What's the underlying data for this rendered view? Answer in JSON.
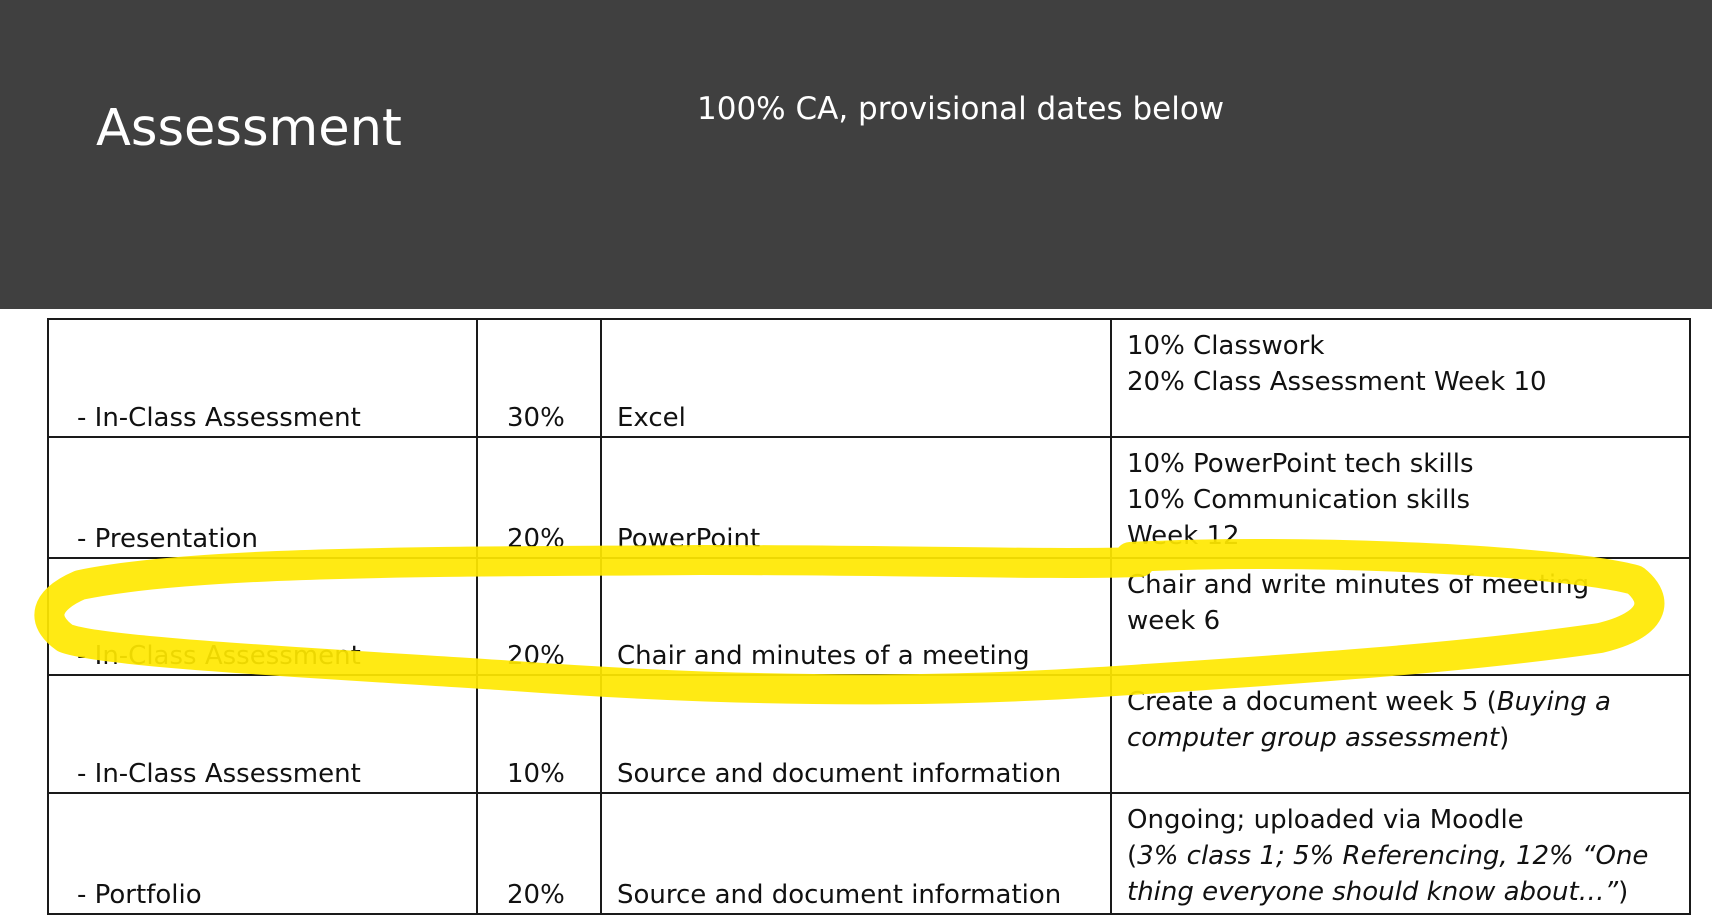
{
  "header": {
    "title": "Assessment",
    "subtitle": "100% CA, provisional dates below",
    "background_color": "#404040"
  },
  "table": {
    "rows": [
      {
        "component": "- In-Class Assessment",
        "weight": "30%",
        "topic": "Excel",
        "detail": {
          "line1": "10% Classwork",
          "line2": "20% Class Assessment Week 10"
        }
      },
      {
        "component": "- Presentation",
        "weight": "20%",
        "topic": "PowerPoint",
        "detail": {
          "line1": "10% PowerPoint tech skills",
          "line2": "10% Communication skills",
          "line3": "Week 12"
        }
      },
      {
        "component": "- In-Class Assessment",
        "weight": "20%",
        "topic": "Chair and minutes of a meeting",
        "detail": {
          "line1": "Chair and write minutes of meeting",
          "line2": "week 6"
        }
      },
      {
        "component": "- In-Class Assessment",
        "weight": "10%",
        "topic": "Source and document information",
        "detail": {
          "line1_prefix": "Create a document week 5 (",
          "line1_italic": "Buying a",
          "line2_italic": "computer group assessment",
          "line2_suffix": ")"
        }
      },
      {
        "component": "- Portfolio",
        "weight": "20%",
        "topic": "Source and document information",
        "detail": {
          "line1": "Ongoing; uploaded via Moodle",
          "line2_prefix": "(",
          "line2_italic": "3% class 1; 5% Referencing, 12% “One",
          "line3_italic": "thing everyone should know about…”",
          "line3_suffix": ")"
        }
      }
    ]
  },
  "annotation": {
    "highlight_color": "#ffe800"
  }
}
